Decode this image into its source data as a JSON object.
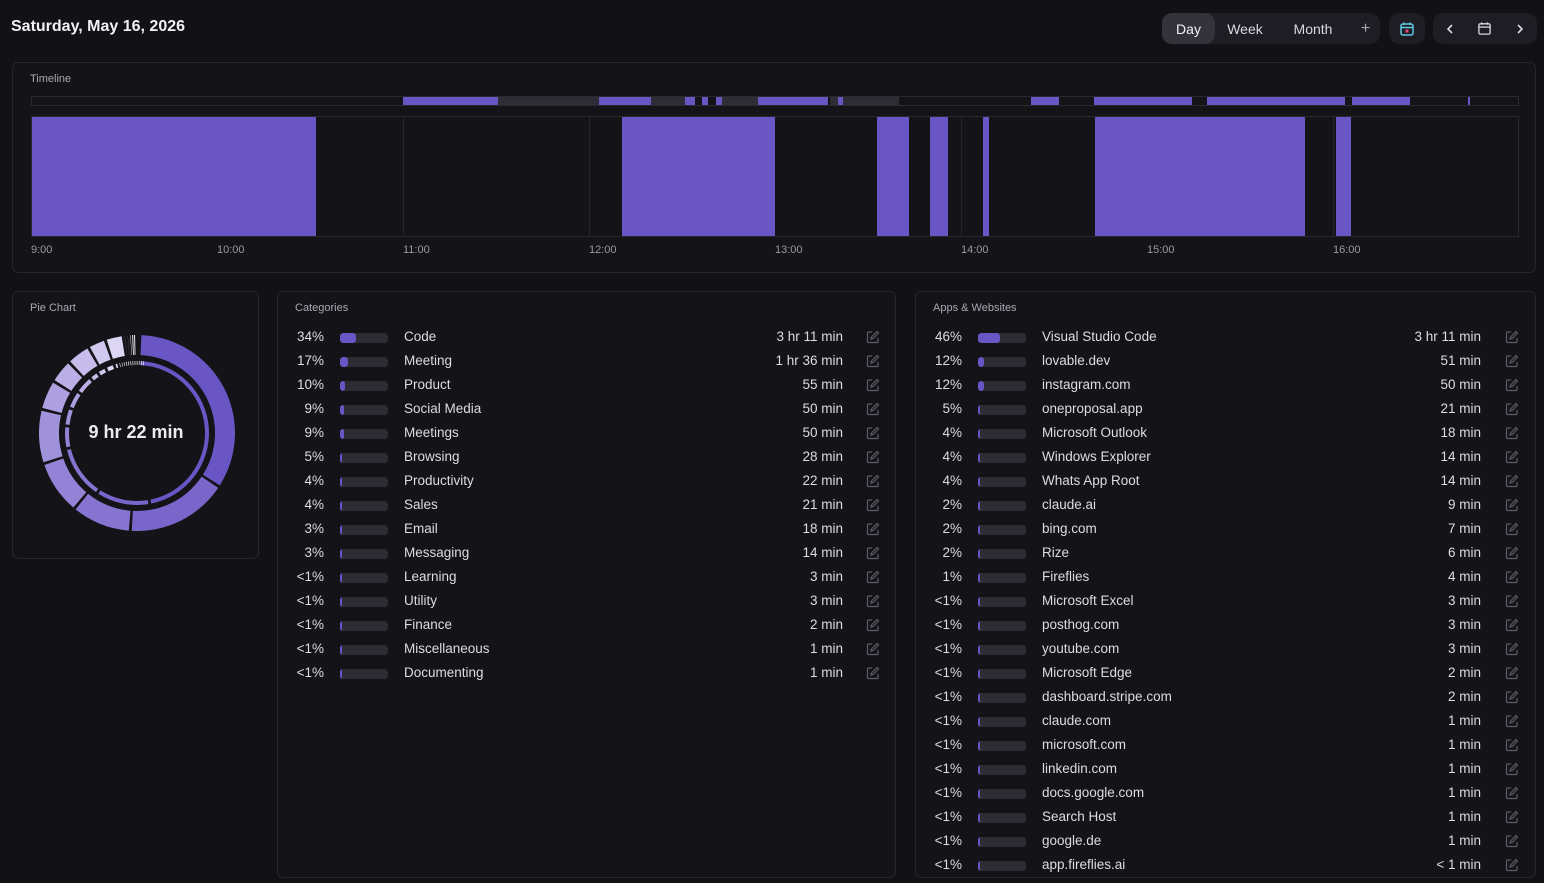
{
  "header": {
    "date": "Saturday, May 16, 2026",
    "views": [
      "Day",
      "Week",
      "Month"
    ],
    "active_view": "Day",
    "add_symbol": "+"
  },
  "colors": {
    "accent": "#6a55c4",
    "background": "#121116",
    "card": "#141318",
    "bar_track": "#2d2c35"
  },
  "timeline": {
    "title": "Timeline",
    "hour_labels": [
      "9:00",
      "10:00",
      "11:00",
      "12:00",
      "13:00",
      "14:00",
      "15:00",
      "16:00"
    ]
  },
  "pie": {
    "title": "Pie Chart",
    "total": "9 hr 22 min"
  },
  "categories": {
    "title": "Categories",
    "items": [
      {
        "pct": "34%",
        "share": 0.34,
        "name": "Code",
        "duration": "3 hr 11 min"
      },
      {
        "pct": "17%",
        "share": 0.17,
        "name": "Meeting",
        "duration": "1 hr 36 min"
      },
      {
        "pct": "10%",
        "share": 0.1,
        "name": "Product",
        "duration": "55 min"
      },
      {
        "pct": "9%",
        "share": 0.09,
        "name": "Social Media",
        "duration": "50 min"
      },
      {
        "pct": "9%",
        "share": 0.09,
        "name": "Meetings",
        "duration": "50 min"
      },
      {
        "pct": "5%",
        "share": 0.05,
        "name": "Browsing",
        "duration": "28 min"
      },
      {
        "pct": "4%",
        "share": 0.04,
        "name": "Productivity",
        "duration": "22 min"
      },
      {
        "pct": "4%",
        "share": 0.04,
        "name": "Sales",
        "duration": "21 min"
      },
      {
        "pct": "3%",
        "share": 0.03,
        "name": "Email",
        "duration": "18 min"
      },
      {
        "pct": "3%",
        "share": 0.03,
        "name": "Messaging",
        "duration": "14 min"
      },
      {
        "pct": "<1%",
        "share": 0.005,
        "name": "Learning",
        "duration": "3 min"
      },
      {
        "pct": "<1%",
        "share": 0.005,
        "name": "Utility",
        "duration": "3 min"
      },
      {
        "pct": "<1%",
        "share": 0.004,
        "name": "Finance",
        "duration": "2 min"
      },
      {
        "pct": "<1%",
        "share": 0.002,
        "name": "Miscellaneous",
        "duration": "1 min"
      },
      {
        "pct": "<1%",
        "share": 0.002,
        "name": "Documenting",
        "duration": "1 min"
      }
    ]
  },
  "apps": {
    "title": "Apps & Websites",
    "items": [
      {
        "pct": "46%",
        "share": 0.46,
        "name": "Visual Studio Code",
        "duration": "3 hr 11 min"
      },
      {
        "pct": "12%",
        "share": 0.12,
        "name": "lovable.dev",
        "duration": "51 min"
      },
      {
        "pct": "12%",
        "share": 0.12,
        "name": "instagram.com",
        "duration": "50 min"
      },
      {
        "pct": "5%",
        "share": 0.05,
        "name": "oneproposal.app",
        "duration": "21 min"
      },
      {
        "pct": "4%",
        "share": 0.04,
        "name": "Microsoft Outlook",
        "duration": "18 min"
      },
      {
        "pct": "4%",
        "share": 0.04,
        "name": "Windows Explorer",
        "duration": "14 min"
      },
      {
        "pct": "4%",
        "share": 0.04,
        "name": "Whats App Root",
        "duration": "14 min"
      },
      {
        "pct": "2%",
        "share": 0.02,
        "name": "claude.ai",
        "duration": "9 min"
      },
      {
        "pct": "2%",
        "share": 0.02,
        "name": "bing.com",
        "duration": "7 min"
      },
      {
        "pct": "2%",
        "share": 0.02,
        "name": "Rize",
        "duration": "6 min"
      },
      {
        "pct": "1%",
        "share": 0.01,
        "name": "Fireflies",
        "duration": "4 min"
      },
      {
        "pct": "<1%",
        "share": 0.005,
        "name": "Microsoft Excel",
        "duration": "3 min"
      },
      {
        "pct": "<1%",
        "share": 0.005,
        "name": "posthog.com",
        "duration": "3 min"
      },
      {
        "pct": "<1%",
        "share": 0.005,
        "name": "youtube.com",
        "duration": "3 min"
      },
      {
        "pct": "<1%",
        "share": 0.004,
        "name": "Microsoft Edge",
        "duration": "2 min"
      },
      {
        "pct": "<1%",
        "share": 0.004,
        "name": "dashboard.stripe.com",
        "duration": "2 min"
      },
      {
        "pct": "<1%",
        "share": 0.002,
        "name": "claude.com",
        "duration": "1 min"
      },
      {
        "pct": "<1%",
        "share": 0.002,
        "name": "microsoft.com",
        "duration": "1 min"
      },
      {
        "pct": "<1%",
        "share": 0.002,
        "name": "linkedin.com",
        "duration": "1 min"
      },
      {
        "pct": "<1%",
        "share": 0.002,
        "name": "docs.google.com",
        "duration": "1 min"
      },
      {
        "pct": "<1%",
        "share": 0.002,
        "name": "Search Host",
        "duration": "1 min"
      },
      {
        "pct": "<1%",
        "share": 0.002,
        "name": "google.de",
        "duration": "1 min"
      },
      {
        "pct": "<1%",
        "share": 0.001,
        "name": "app.fireflies.ai",
        "duration": "< 1 min"
      }
    ]
  }
}
